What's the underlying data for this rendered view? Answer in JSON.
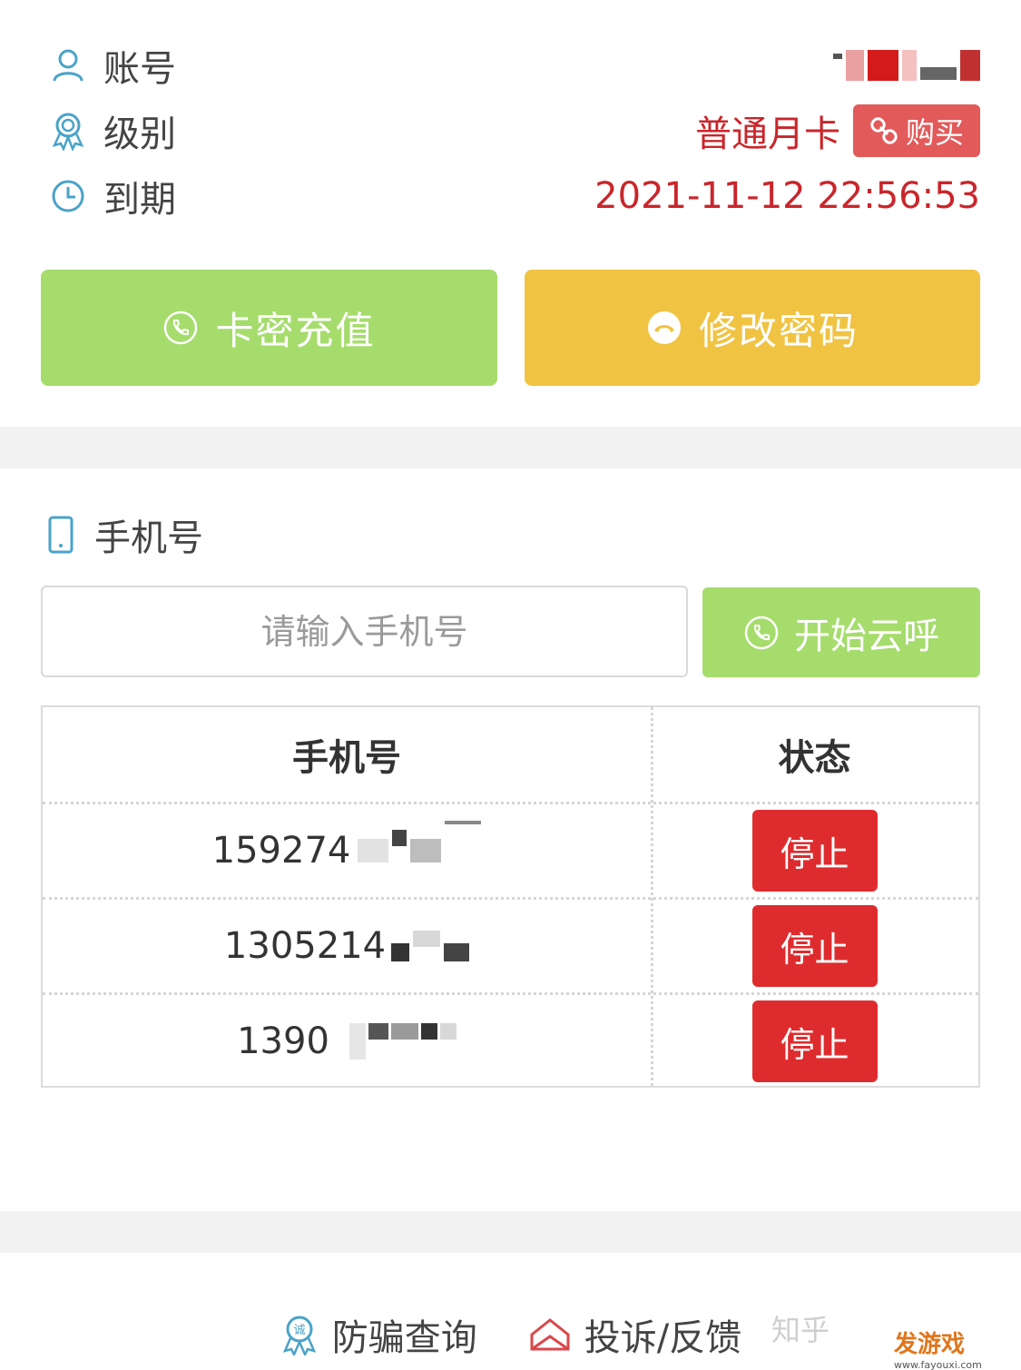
{
  "account": {
    "account_label": "账号",
    "level_label": "级别",
    "expire_label": "到期",
    "level_value": "普通月卡",
    "buy_label": "购买",
    "expire_value": "2021-11-12 22:56:53"
  },
  "actions": {
    "recharge_label": "卡密充值",
    "change_password_label": "修改密码"
  },
  "phone_section": {
    "title": "手机号",
    "input_placeholder": "请输入手机号",
    "call_label": "开始云呼"
  },
  "table": {
    "headers": [
      "手机号",
      "状态"
    ],
    "rows": [
      {
        "phone_prefix": "159274",
        "action": "停止"
      },
      {
        "phone_prefix": "1305214",
        "action": "停止"
      },
      {
        "phone_prefix": "1390",
        "action": "停止"
      }
    ]
  },
  "footer": {
    "anti_fraud_label": "防骗查询",
    "feedback_label": "投诉/反馈"
  },
  "watermarks": {
    "zhihu": "知乎",
    "site": "发游戏",
    "site_url": "www.fayouxi.com"
  },
  "colors": {
    "red_text": "#c9262b",
    "green": "#a6dc6c",
    "yellow": "#f0c343",
    "stop": "#de2c2e",
    "icon_blue": "#4aa3c8"
  }
}
